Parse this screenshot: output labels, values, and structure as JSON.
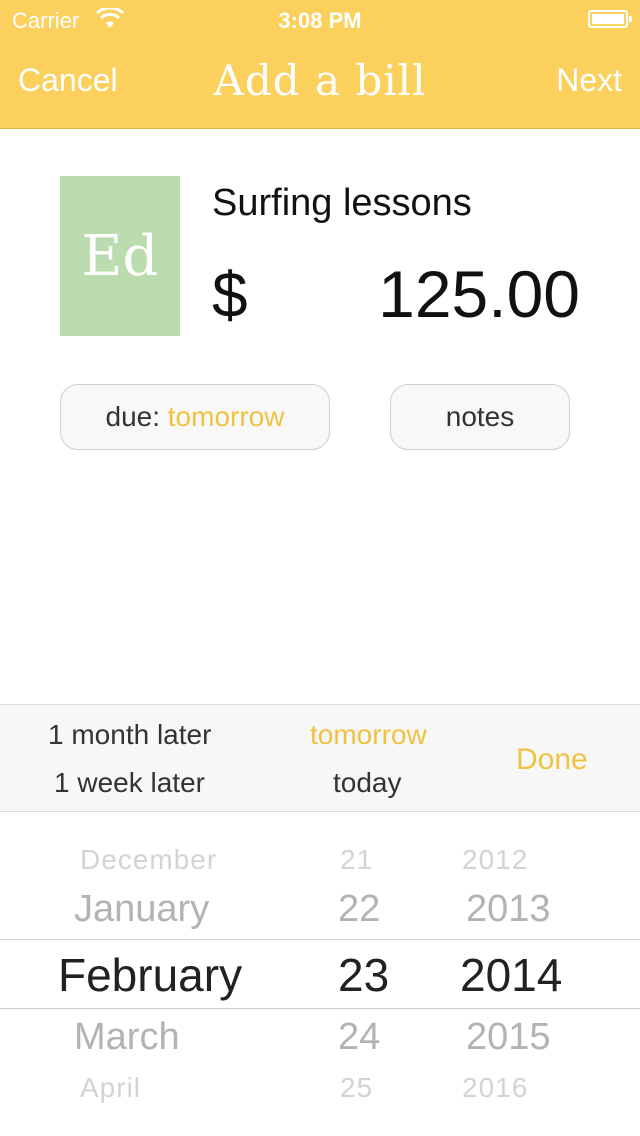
{
  "status_bar": {
    "carrier": "Carrier",
    "time": "3:08 PM"
  },
  "nav": {
    "cancel": "Cancel",
    "title": "Add a bill",
    "next": "Next"
  },
  "bill": {
    "avatar_initials": "Ed",
    "avatar_color": "#bbdcae",
    "name": "Surfing lessons",
    "currency": "$",
    "amount": "125.00"
  },
  "actions": {
    "due_label": "due:",
    "due_value": "tomorrow",
    "notes": "notes"
  },
  "quick_options": {
    "month_later": "1 month later",
    "week_later": "1 week later",
    "tomorrow": "tomorrow",
    "today": "today",
    "done": "Done"
  },
  "picker": {
    "months": [
      "December",
      "January",
      "February",
      "March",
      "April"
    ],
    "days": [
      "21",
      "22",
      "23",
      "24",
      "25"
    ],
    "years": [
      "2012",
      "2013",
      "2014",
      "2015",
      "2016"
    ]
  },
  "colors": {
    "accent": "#f0c240",
    "header": "#fbd05c"
  }
}
